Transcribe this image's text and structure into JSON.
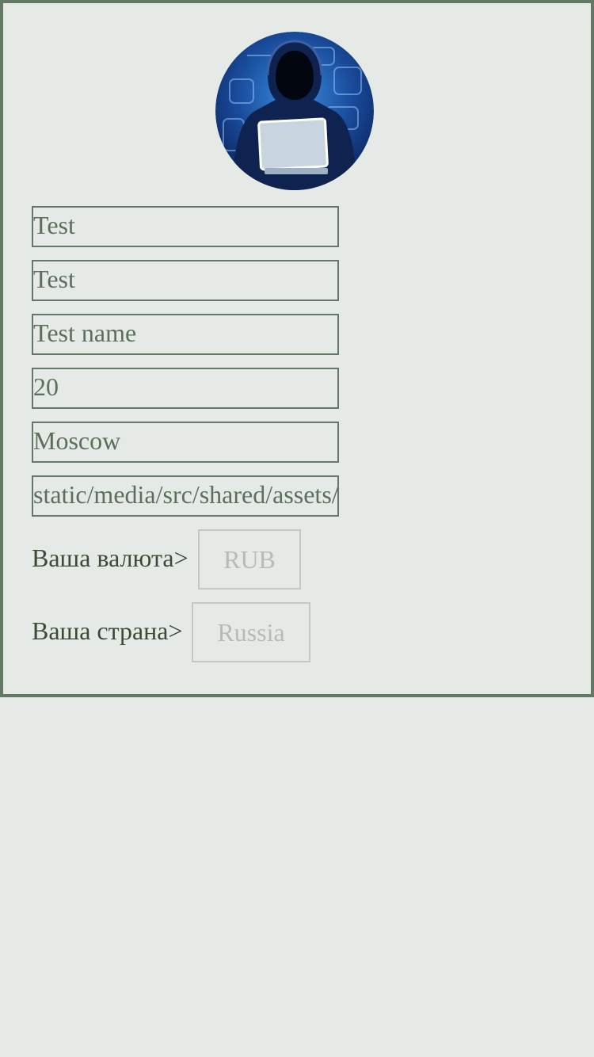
{
  "profile": {
    "avatar_icon": "hacker-avatar-icon",
    "fields": [
      {
        "name": "first-name-field",
        "value": "Test"
      },
      {
        "name": "last-name-field",
        "value": "Test"
      },
      {
        "name": "display-name-field",
        "value": "Test name"
      },
      {
        "name": "age-field",
        "value": "20"
      },
      {
        "name": "city-field",
        "value": "Moscow"
      },
      {
        "name": "avatar-path-field",
        "value": "static/media/src/shared/assets/"
      }
    ],
    "currency": {
      "label": "Ваша валюта>",
      "value": "RUB"
    },
    "country": {
      "label": "Ваша страна>",
      "value": "Russia"
    }
  },
  "colors": {
    "background": "#e6eae6",
    "border": "#637865",
    "field_text": "#5b6f5c",
    "label_text": "#3a4a36",
    "select_border": "#c3c8c3",
    "select_text": "#b6bbb6",
    "avatar_blue": "#1a4c9c"
  }
}
